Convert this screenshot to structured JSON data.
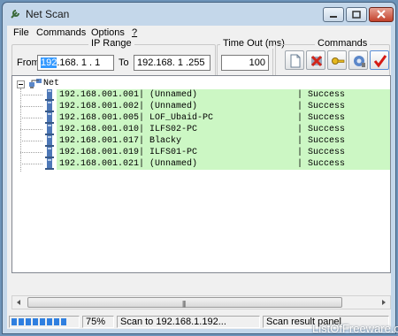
{
  "window": {
    "title": "Net Scan"
  },
  "menu": [
    "File",
    "Commands",
    "Options",
    "?"
  ],
  "ip_range": {
    "title": "IP Range",
    "from_label": "From",
    "from_selected": "192",
    "from_rest": ".168.  1 .  1",
    "to_label": "To",
    "to_value": "192.168.  1 .255"
  },
  "timeout": {
    "title": "Time Out (ms)",
    "value": "100"
  },
  "commands": {
    "title": "Commands",
    "buttons": [
      "new-scan-icon",
      "stop-scan-icon",
      "key-icon",
      "network-settings-icon",
      "checkmark-icon"
    ]
  },
  "tree": {
    "root": "Net",
    "rows": [
      {
        "text": "192.168.001.001| (Unnamed)",
        "status": "| Success"
      },
      {
        "text": "192.168.001.002| (Unnamed)",
        "status": "| Success"
      },
      {
        "text": "192.168.001.005| LOF_Ubaid-PC",
        "status": "| Success"
      },
      {
        "text": "192.168.001.010| ILFS02-PC",
        "status": "| Success"
      },
      {
        "text": "192.168.001.017| Blacky",
        "status": "| Success"
      },
      {
        "text": "192.168.001.019| ILFS01-PC",
        "status": "| Success"
      },
      {
        "text": "192.168.001.021| (Unnamed)",
        "status": "| Success"
      }
    ]
  },
  "status": {
    "progress_percent": 75,
    "percent_text": "75%",
    "scan_text": "Scan to 192.168.1.192...",
    "panel_text": "Scan result panel"
  },
  "watermark": "ListOfFreeware.com",
  "colors": {
    "success_band": "#ccf7c4",
    "progress": "#2f7fe0",
    "selection": "#3399ff"
  }
}
